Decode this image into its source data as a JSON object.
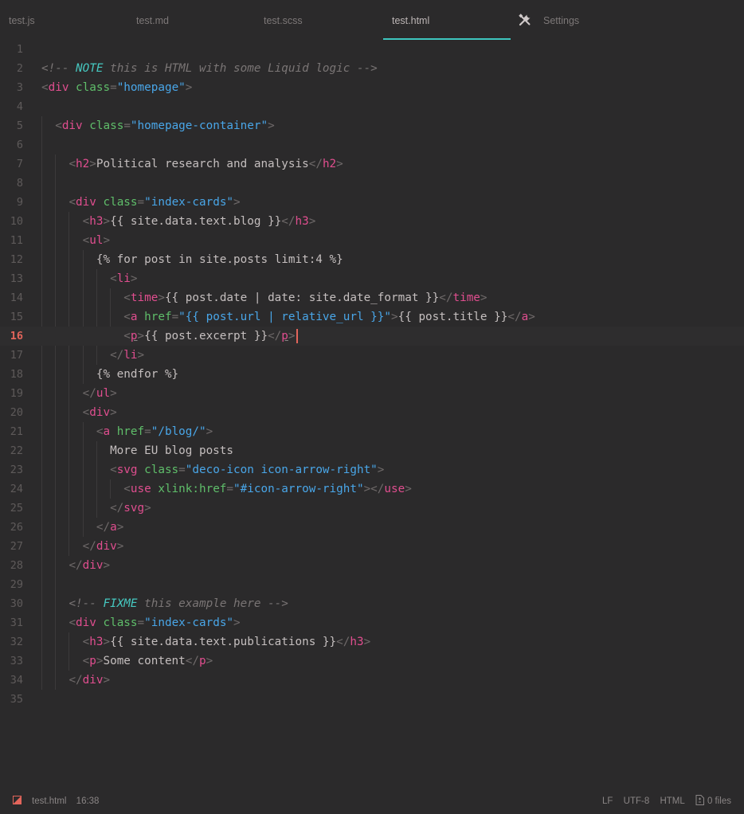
{
  "tabs": [
    {
      "label": "test.js",
      "active": false
    },
    {
      "label": "test.md",
      "active": false
    },
    {
      "label": "test.scss",
      "active": false
    },
    {
      "label": "test.html",
      "active": true
    },
    {
      "label": "Settings",
      "active": false,
      "icon": "tools-icon"
    }
  ],
  "colors": {
    "accent": "#3ec6be",
    "tag": "#e04e8f",
    "attribute": "#5fbe6a",
    "string": "#49a6e8",
    "comment": "#7a7575",
    "keyword": "#46c8c0",
    "cursor": "#e3655b"
  },
  "editor": {
    "current_line": 16,
    "lines": [
      {
        "n": "1",
        "tokens": []
      },
      {
        "n": "2",
        "tokens": [
          [
            "cm",
            "<!-- "
          ],
          [
            "kw",
            "NOTE"
          ],
          [
            "cm",
            " this is HTML with some Liquid logic -->"
          ]
        ]
      },
      {
        "n": "3",
        "tokens": [
          [
            "br",
            "<"
          ],
          [
            "tag",
            "div"
          ],
          [
            "txt",
            " "
          ],
          [
            "attr",
            "class"
          ],
          [
            "br",
            "="
          ],
          [
            "str",
            "\"homepage\""
          ],
          [
            "br",
            ">"
          ]
        ]
      },
      {
        "n": "4",
        "tokens": []
      },
      {
        "n": "5",
        "tokens": [
          [
            "txt",
            "  "
          ],
          [
            "br",
            "<"
          ],
          [
            "tag",
            "div"
          ],
          [
            "txt",
            " "
          ],
          [
            "attr",
            "class"
          ],
          [
            "br",
            "="
          ],
          [
            "str",
            "\"homepage-container\""
          ],
          [
            "br",
            ">"
          ]
        ]
      },
      {
        "n": "6",
        "tokens": []
      },
      {
        "n": "7",
        "tokens": [
          [
            "txt",
            "    "
          ],
          [
            "br",
            "<"
          ],
          [
            "tag",
            "h2"
          ],
          [
            "br",
            ">"
          ],
          [
            "txt",
            "Political research and analysis"
          ],
          [
            "br",
            "</"
          ],
          [
            "tag",
            "h2"
          ],
          [
            "br",
            ">"
          ]
        ]
      },
      {
        "n": "8",
        "tokens": []
      },
      {
        "n": "9",
        "tokens": [
          [
            "txt",
            "    "
          ],
          [
            "br",
            "<"
          ],
          [
            "tag",
            "div"
          ],
          [
            "txt",
            " "
          ],
          [
            "attr",
            "class"
          ],
          [
            "br",
            "="
          ],
          [
            "str",
            "\"index-cards\""
          ],
          [
            "br",
            ">"
          ]
        ]
      },
      {
        "n": "10",
        "tokens": [
          [
            "txt",
            "      "
          ],
          [
            "br",
            "<"
          ],
          [
            "tag",
            "h3"
          ],
          [
            "br",
            ">"
          ],
          [
            "txt",
            "{{ site.data.text.blog }}"
          ],
          [
            "br",
            "</"
          ],
          [
            "tag",
            "h3"
          ],
          [
            "br",
            ">"
          ]
        ]
      },
      {
        "n": "11",
        "tokens": [
          [
            "txt",
            "      "
          ],
          [
            "br",
            "<"
          ],
          [
            "tag",
            "ul"
          ],
          [
            "br",
            ">"
          ]
        ]
      },
      {
        "n": "12",
        "tokens": [
          [
            "txt",
            "        {% for post in site.posts limit:4 %}"
          ]
        ]
      },
      {
        "n": "13",
        "tokens": [
          [
            "txt",
            "          "
          ],
          [
            "br",
            "<"
          ],
          [
            "tag",
            "li"
          ],
          [
            "br",
            ">"
          ]
        ]
      },
      {
        "n": "14",
        "tokens": [
          [
            "txt",
            "            "
          ],
          [
            "br",
            "<"
          ],
          [
            "tag",
            "time"
          ],
          [
            "br",
            ">"
          ],
          [
            "txt",
            "{{ post.date | date: site.date_format }}"
          ],
          [
            "br",
            "</"
          ],
          [
            "tag",
            "time"
          ],
          [
            "br",
            ">"
          ]
        ]
      },
      {
        "n": "15",
        "tokens": [
          [
            "txt",
            "            "
          ],
          [
            "br",
            "<"
          ],
          [
            "tag",
            "a"
          ],
          [
            "txt",
            " "
          ],
          [
            "attr",
            "href"
          ],
          [
            "br",
            "="
          ],
          [
            "str",
            "\"{{ post.url | relative_url }}\""
          ],
          [
            "br",
            ">"
          ],
          [
            "txt",
            "{{ post.title }}"
          ],
          [
            "br",
            "</"
          ],
          [
            "tag",
            "a"
          ],
          [
            "br",
            ">"
          ]
        ]
      },
      {
        "n": "16",
        "tokens": [
          [
            "txt",
            "            "
          ],
          [
            "br",
            "<"
          ],
          [
            "tagu",
            "p"
          ],
          [
            "br",
            ">"
          ],
          [
            "txt",
            "{{ post.excerpt }}"
          ],
          [
            "br",
            "</"
          ],
          [
            "tagu",
            "p"
          ],
          [
            "br",
            ">"
          ]
        ],
        "cursor": true
      },
      {
        "n": "17",
        "tokens": [
          [
            "txt",
            "          "
          ],
          [
            "br",
            "</"
          ],
          [
            "tag",
            "li"
          ],
          [
            "br",
            ">"
          ]
        ]
      },
      {
        "n": "18",
        "tokens": [
          [
            "txt",
            "        {% endfor %}"
          ]
        ]
      },
      {
        "n": "19",
        "tokens": [
          [
            "txt",
            "      "
          ],
          [
            "br",
            "</"
          ],
          [
            "tag",
            "ul"
          ],
          [
            "br",
            ">"
          ]
        ]
      },
      {
        "n": "20",
        "tokens": [
          [
            "txt",
            "      "
          ],
          [
            "br",
            "<"
          ],
          [
            "tag",
            "div"
          ],
          [
            "br",
            ">"
          ]
        ]
      },
      {
        "n": "21",
        "tokens": [
          [
            "txt",
            "        "
          ],
          [
            "br",
            "<"
          ],
          [
            "tag",
            "a"
          ],
          [
            "txt",
            " "
          ],
          [
            "attr",
            "href"
          ],
          [
            "br",
            "="
          ],
          [
            "str",
            "\"/blog/\""
          ],
          [
            "br",
            ">"
          ]
        ]
      },
      {
        "n": "22",
        "tokens": [
          [
            "txt",
            "          More EU blog posts"
          ]
        ]
      },
      {
        "n": "23",
        "tokens": [
          [
            "txt",
            "          "
          ],
          [
            "br",
            "<"
          ],
          [
            "tag",
            "svg"
          ],
          [
            "txt",
            " "
          ],
          [
            "attr",
            "class"
          ],
          [
            "br",
            "="
          ],
          [
            "str",
            "\"deco-icon icon-arrow-right\""
          ],
          [
            "br",
            ">"
          ]
        ]
      },
      {
        "n": "24",
        "tokens": [
          [
            "txt",
            "            "
          ],
          [
            "br",
            "<"
          ],
          [
            "tag",
            "use"
          ],
          [
            "txt",
            " "
          ],
          [
            "attr",
            "xlink:href"
          ],
          [
            "br",
            "="
          ],
          [
            "str",
            "\"#icon-arrow-right\""
          ],
          [
            "br",
            "></"
          ],
          [
            "tag",
            "use"
          ],
          [
            "br",
            ">"
          ]
        ]
      },
      {
        "n": "25",
        "tokens": [
          [
            "txt",
            "          "
          ],
          [
            "br",
            "</"
          ],
          [
            "tag",
            "svg"
          ],
          [
            "br",
            ">"
          ]
        ]
      },
      {
        "n": "26",
        "tokens": [
          [
            "txt",
            "        "
          ],
          [
            "br",
            "</"
          ],
          [
            "tag",
            "a"
          ],
          [
            "br",
            ">"
          ]
        ]
      },
      {
        "n": "27",
        "tokens": [
          [
            "txt",
            "      "
          ],
          [
            "br",
            "</"
          ],
          [
            "tag",
            "div"
          ],
          [
            "br",
            ">"
          ]
        ]
      },
      {
        "n": "28",
        "tokens": [
          [
            "txt",
            "    "
          ],
          [
            "br",
            "</"
          ],
          [
            "tag",
            "div"
          ],
          [
            "br",
            ">"
          ]
        ]
      },
      {
        "n": "29",
        "tokens": []
      },
      {
        "n": "30",
        "tokens": [
          [
            "txt",
            "    "
          ],
          [
            "cm",
            "<!-- "
          ],
          [
            "kw",
            "FIXME"
          ],
          [
            "cm",
            " this example here -->"
          ]
        ]
      },
      {
        "n": "31",
        "tokens": [
          [
            "txt",
            "    "
          ],
          [
            "br",
            "<"
          ],
          [
            "tag",
            "div"
          ],
          [
            "txt",
            " "
          ],
          [
            "attr",
            "class"
          ],
          [
            "br",
            "="
          ],
          [
            "str",
            "\"index-cards\""
          ],
          [
            "br",
            ">"
          ]
        ]
      },
      {
        "n": "32",
        "tokens": [
          [
            "txt",
            "      "
          ],
          [
            "br",
            "<"
          ],
          [
            "tag",
            "h3"
          ],
          [
            "br",
            ">"
          ],
          [
            "txt",
            "{{ site.data.text.publications }}"
          ],
          [
            "br",
            "</"
          ],
          [
            "tag",
            "h3"
          ],
          [
            "br",
            ">"
          ]
        ]
      },
      {
        "n": "33",
        "tokens": [
          [
            "txt",
            "      "
          ],
          [
            "br",
            "<"
          ],
          [
            "tag",
            "p"
          ],
          [
            "br",
            ">"
          ],
          [
            "txt",
            "Some content"
          ],
          [
            "br",
            "</"
          ],
          [
            "tag",
            "p"
          ],
          [
            "br",
            ">"
          ]
        ]
      },
      {
        "n": "34",
        "tokens": [
          [
            "txt",
            "    "
          ],
          [
            "br",
            "</"
          ],
          [
            "tag",
            "div"
          ],
          [
            "br",
            ">"
          ]
        ]
      },
      {
        "n": "35",
        "tokens": []
      }
    ]
  },
  "status": {
    "file": "test.html",
    "position": "16:38",
    "line_ending": "LF",
    "encoding": "UTF-8",
    "language": "HTML",
    "files": "0 files"
  }
}
